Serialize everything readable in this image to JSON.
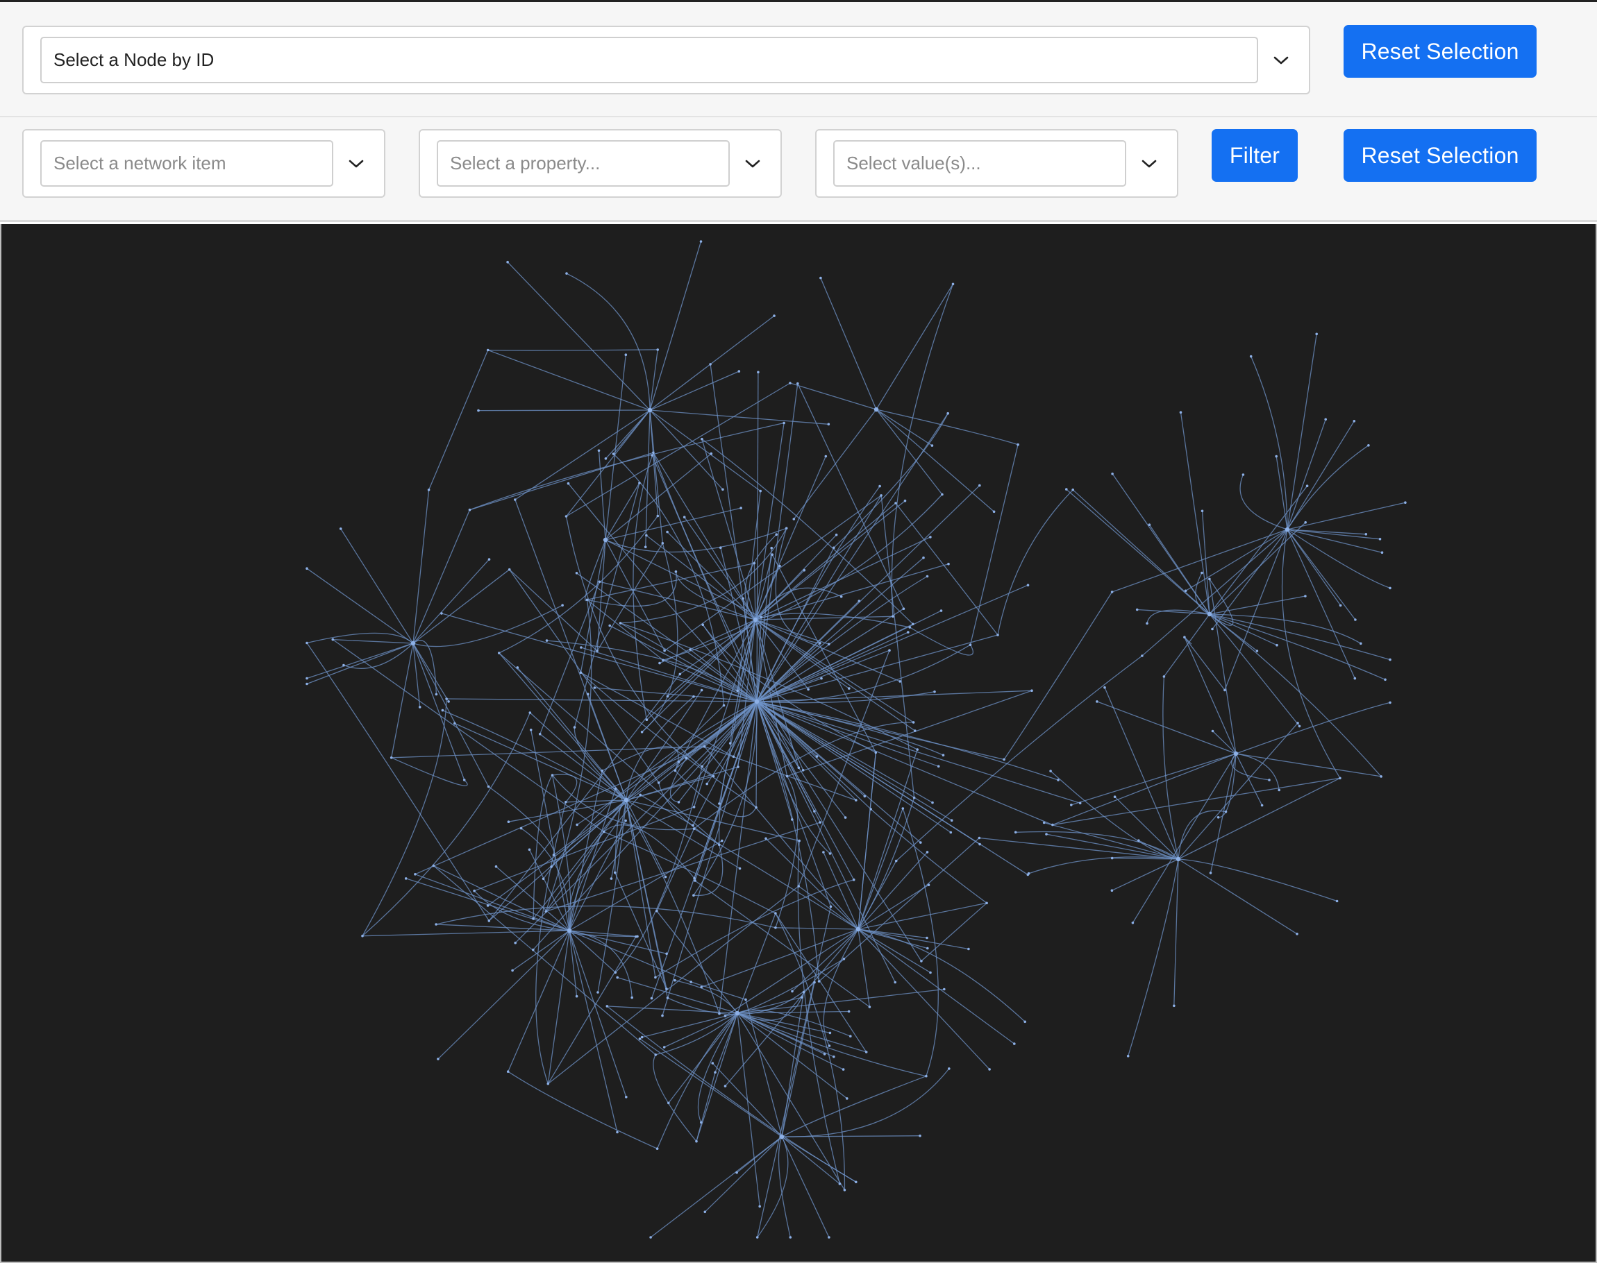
{
  "node_select": {
    "value": "Select a Node by ID",
    "reset_label": "Reset Selection"
  },
  "filters": {
    "network_item_placeholder": "Select a network item",
    "property_placeholder": "Select a property...",
    "values_placeholder": "Select value(s)...",
    "filter_label": "Filter",
    "reset_label": "Reset Selection"
  },
  "graph": {
    "background": "#1e1e1e",
    "edge_color": "#6f93c8",
    "node_color": "#8db0e6"
  },
  "colors": {
    "accent": "#1470f2",
    "toolbar_bg": "#f6f6f6"
  },
  "icons": {
    "dropdown": "chevron-down-icon"
  }
}
